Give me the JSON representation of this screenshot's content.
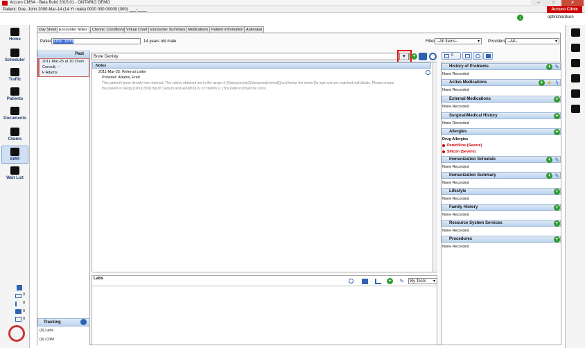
{
  "window": {
    "title": "Accuro CMS4 - Beta Build 2015.01 - ONTARIO DEMO",
    "patient_line": "Patient: Doe, John 2000-Mar-14 (14 Yr male) 0000 000 00000 (000) ___-____",
    "clinic": "Accuro Clinic",
    "user": "opfirichardson",
    "min": "–",
    "max": "□",
    "close": "✕"
  },
  "nav": [
    {
      "label": "Home",
      "icon": "home-icon"
    },
    {
      "label": "Scheduler",
      "icon": "calendar-icon"
    },
    {
      "label": "Traffic",
      "icon": "traffic-icon"
    },
    {
      "label": "Patients",
      "icon": "person-icon"
    },
    {
      "label": "Documents",
      "icon": "document-icon"
    },
    {
      "label": "Claims",
      "icon": "wallet-icon"
    },
    {
      "label": "EMR",
      "icon": "emr-icon"
    },
    {
      "label": "Wait List",
      "icon": "waitlist-icon"
    }
  ],
  "tabs": [
    "Day Sheet",
    "Encounter Notes",
    "Chronic Conditions",
    "Virtual Chart",
    "Encounter Summary",
    "Medications",
    "Patient Information",
    "Antenatal"
  ],
  "patient": {
    "label": "Patient",
    "name": "Doe, John",
    "age": "14 years old male"
  },
  "filter": {
    "label": "Filter",
    "value": "--All Items--",
    "providers_label": "Providers",
    "providers_value": "--All--"
  },
  "past": {
    "header": "Past",
    "item_date": "2011-Mar-25 at 10:15am",
    "item_type": "Consult, --",
    "item_provider": "F Adams"
  },
  "note_selector": {
    "value": "Bone Denisty"
  },
  "notes": {
    "header": "Notes",
    "entry_title": "2011-Mar-25: Referral Letter",
    "entry_provider": "Provider: Adams, Fred",
    "entry_text1": "This patient's bone density has returned. The values obtained are in the range of [Osteoporosis|Osteopenia|normal||] and below the mean [for age and sex matched individuals.    Please ensure",
    "entry_text2": "the patient is taking [1000|1500] mg of Calcium and [400|800] IU of Vitamin D. [The patient should be consi..."
  },
  "labs": {
    "header": "Labs",
    "sort": "By Tests"
  },
  "tracking": {
    "header": "Tracking",
    "items": [
      "(0) Labs",
      "(0) CDM"
    ]
  },
  "counters": [
    "0",
    "0",
    "0",
    "0"
  ],
  "right_toolbar": {
    "count": "0"
  },
  "sections": [
    {
      "title": "History of Problems",
      "body": [
        "None Recorded"
      ]
    },
    {
      "title": "Active Medications",
      "body": [
        "None Recorded"
      ]
    },
    {
      "title": "External Medications",
      "body": [
        "None Recorded"
      ]
    },
    {
      "title": "Surgical/Medical History",
      "body": [
        "None Recorded"
      ]
    },
    {
      "title": "Allergies",
      "body": [
        "Drug Allergies",
        "Penicillins (Severe)",
        "Silicon (Severe)"
      ]
    },
    {
      "title": "Immunization Schedule",
      "body": [
        "None Recorded"
      ]
    },
    {
      "title": "Immunization Summary",
      "body": [
        "None Recorded"
      ]
    },
    {
      "title": "Lifestyle",
      "body": [
        "None Recorded"
      ]
    },
    {
      "title": "Family History",
      "body": [
        "None Recorded"
      ]
    },
    {
      "title": "Resource System Services",
      "body": [
        "None Recorded"
      ]
    },
    {
      "title": "Procedures",
      "body": [
        "None Recorded"
      ]
    }
  ]
}
